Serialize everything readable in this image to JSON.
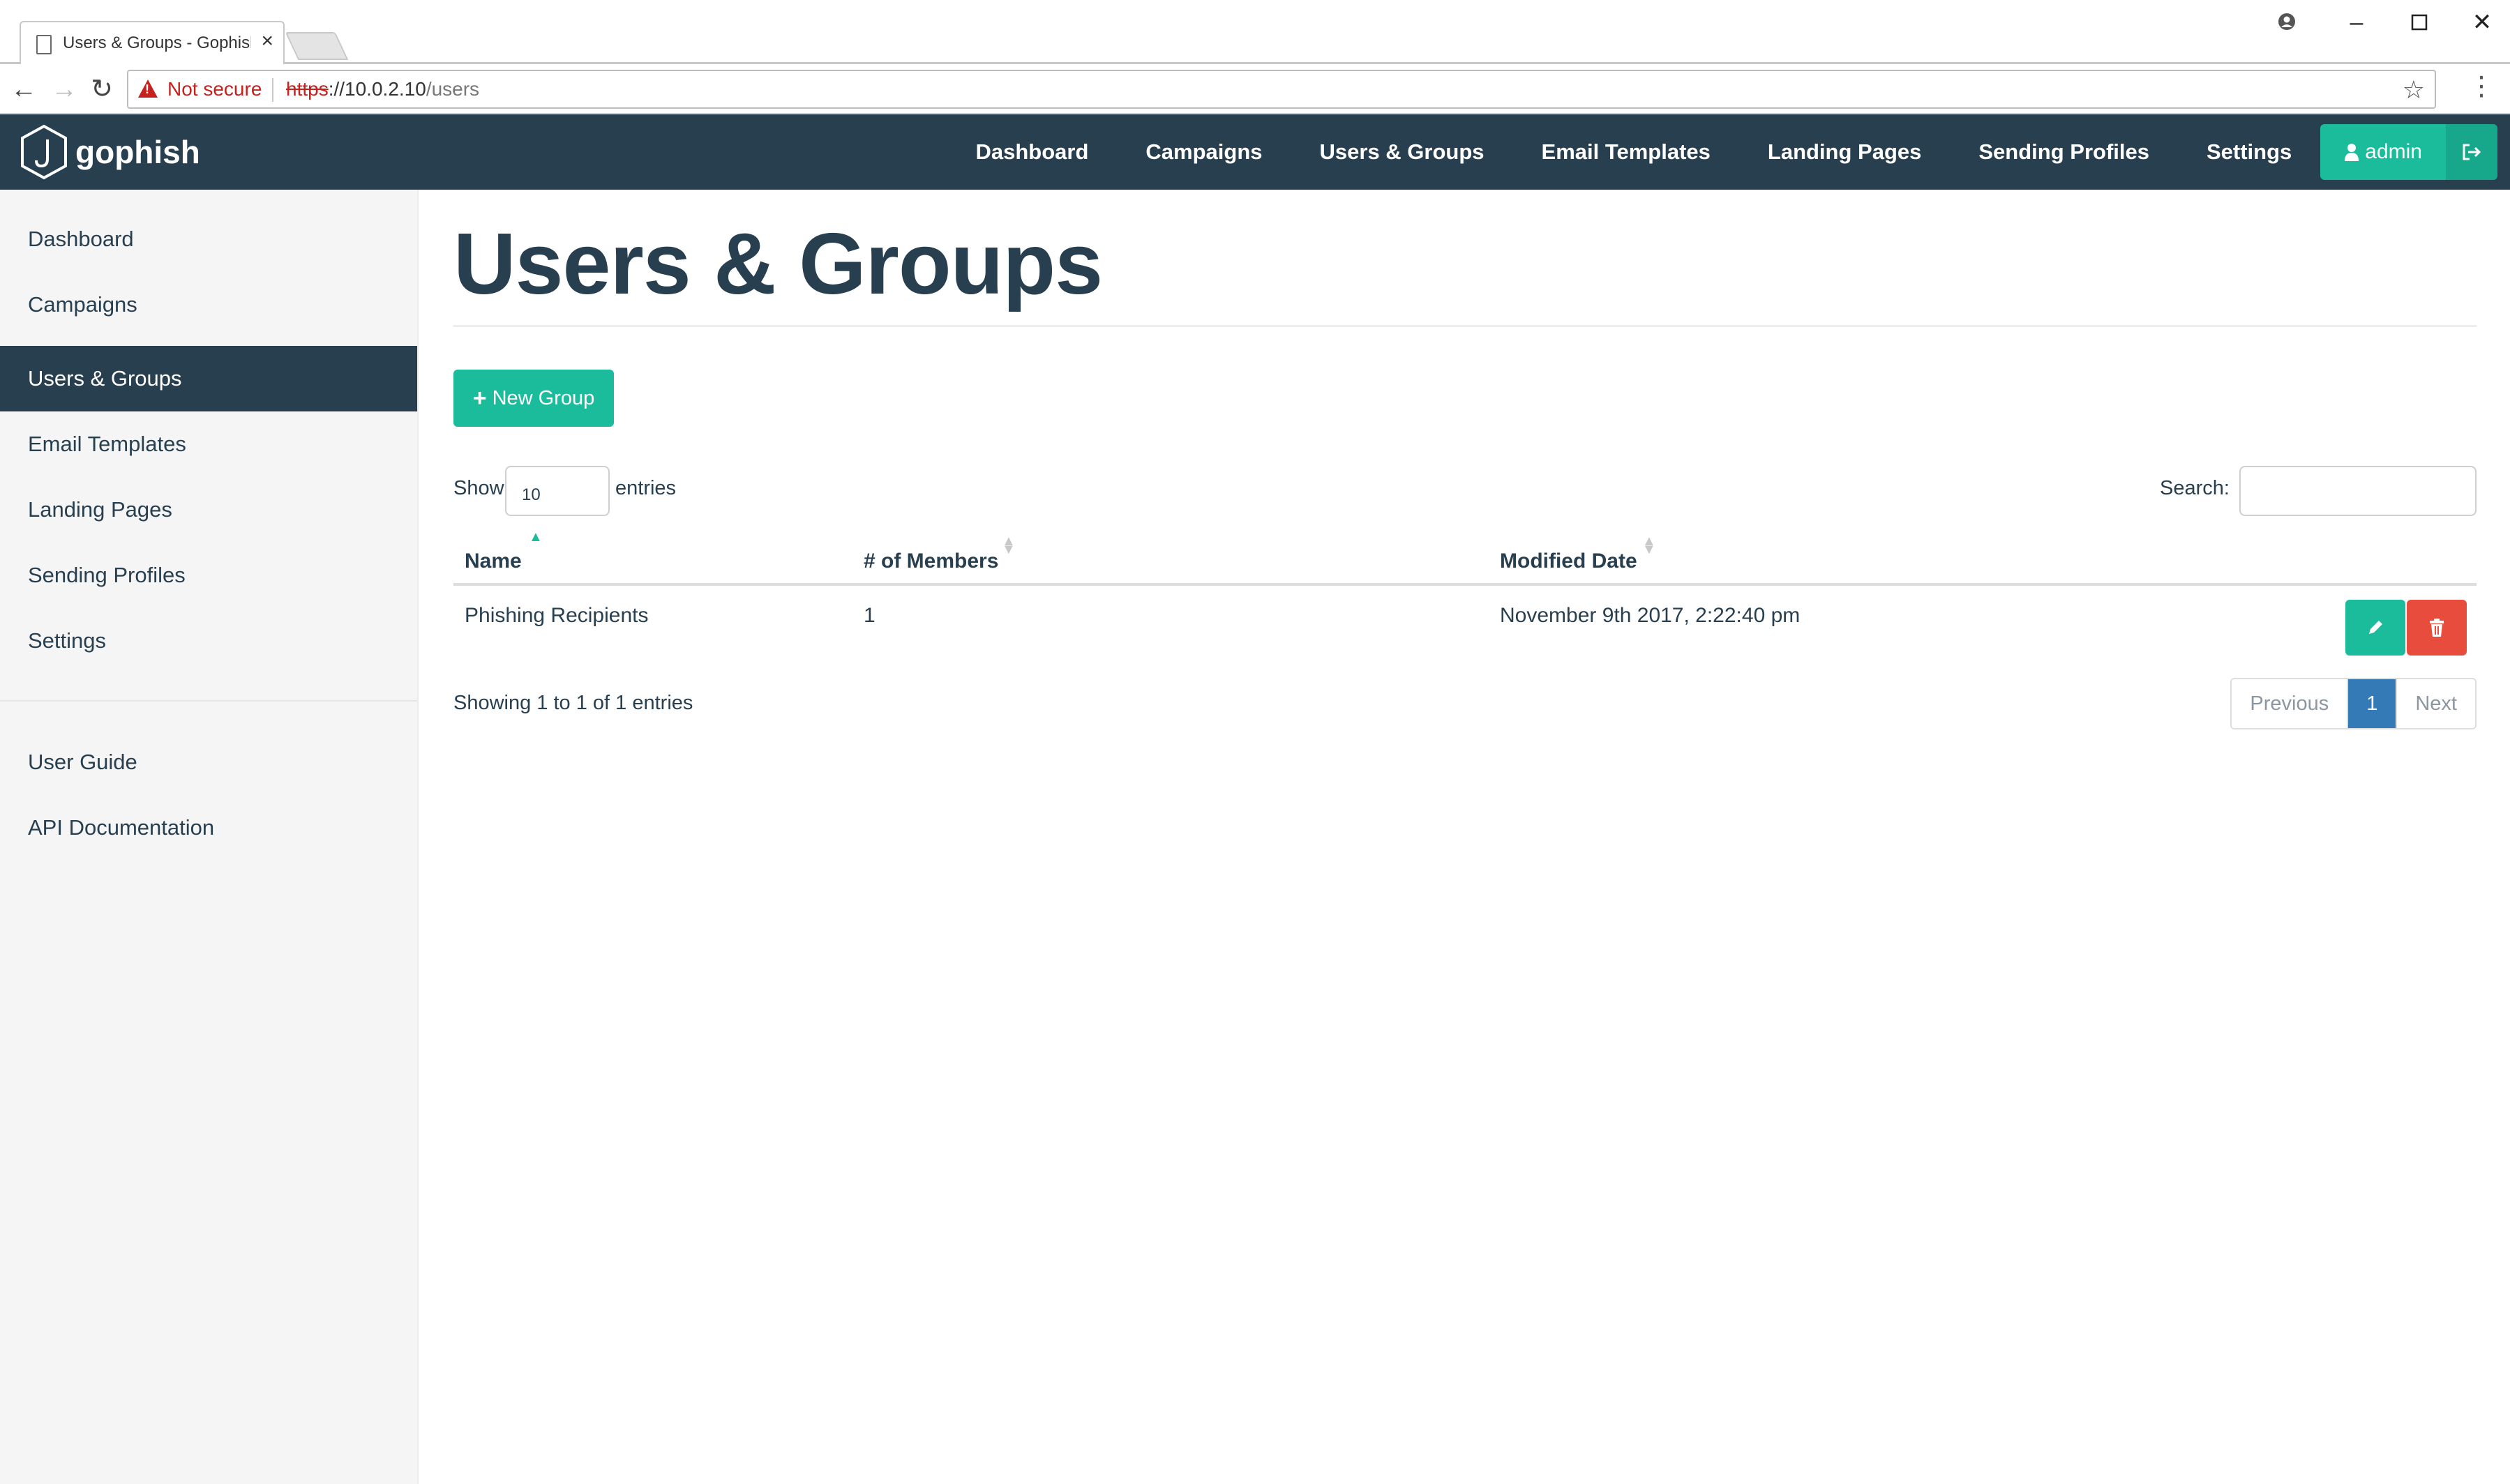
{
  "browser": {
    "tab_title": "Users & Groups - Gophish",
    "security_label": "Not secure",
    "url_scheme": "https",
    "url_host": "://10.0.2.10",
    "url_path": "/users"
  },
  "navbar": {
    "brand": "gophish",
    "links": [
      "Dashboard",
      "Campaigns",
      "Users & Groups",
      "Email Templates",
      "Landing Pages",
      "Sending Profiles",
      "Settings"
    ],
    "user": "admin"
  },
  "sidebar": {
    "items": [
      "Dashboard",
      "Campaigns",
      "Users & Groups",
      "Email Templates",
      "Landing Pages",
      "Sending Profiles",
      "Settings"
    ],
    "active_index": 2,
    "help_items": [
      "User Guide",
      "API Documentation"
    ]
  },
  "main": {
    "title": "Users & Groups",
    "new_group_label": "New Group",
    "show_label": "Show",
    "page_size": "10",
    "entries_label": "entries",
    "search_label": "Search:",
    "columns": [
      "Name",
      "# of Members",
      "Modified Date"
    ],
    "rows": [
      {
        "name": "Phishing Recipients",
        "members": "1",
        "modified": "November 9th 2017, 2:22:40 pm"
      }
    ],
    "info": "Showing 1 to 1 of 1 entries",
    "pagination": {
      "previous": "Previous",
      "current": "1",
      "next": "Next"
    }
  },
  "colors": {
    "navbar": "#283f50",
    "accent": "#1abc9c",
    "danger": "#e74c3c",
    "page_active": "#337ab7"
  }
}
